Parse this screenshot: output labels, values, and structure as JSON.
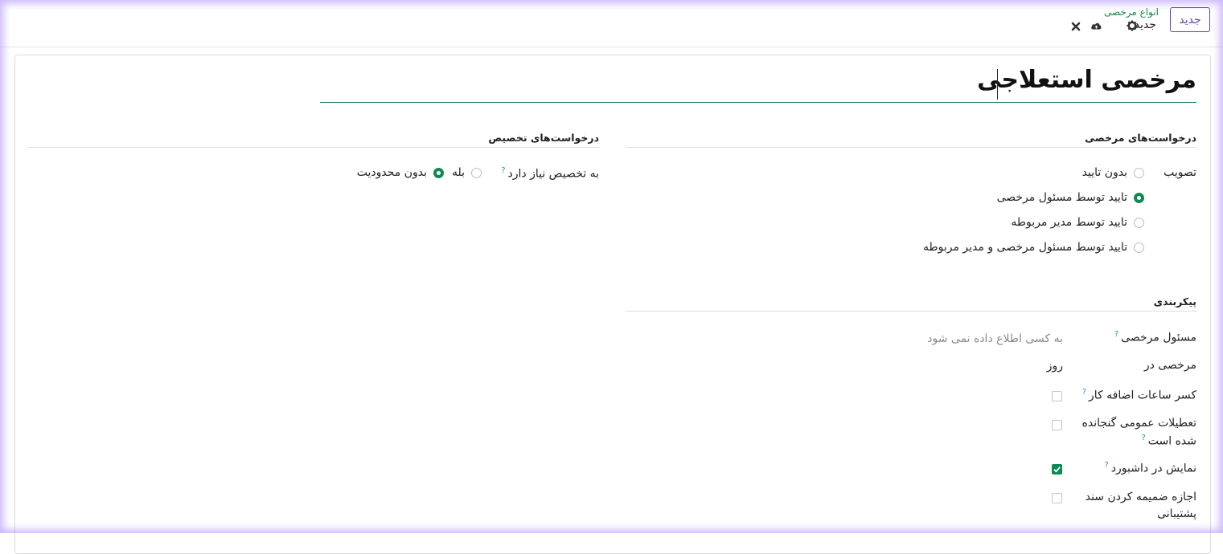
{
  "control_panel": {
    "new_button": "جدید",
    "breadcrumb_parent": "انواع مرخصی",
    "breadcrumb_current": "جدید",
    "icons": [
      "gear-icon",
      "cloud-upload-icon",
      "close-icon"
    ]
  },
  "form": {
    "title": "مرخصی استعلاجی",
    "leave_requests": {
      "heading": "درخواست‌های مرخصی",
      "approval_label": "تصویب",
      "options": [
        {
          "label": "بدون تایید",
          "checked": false
        },
        {
          "label": "تایید توسط مسئول مرخصی",
          "checked": true
        },
        {
          "label": "تایید توسط مدیر مربوطه",
          "checked": false
        },
        {
          "label": "تایید توسط مسئول مرخصی و مدیر مربوطه",
          "checked": false
        }
      ]
    },
    "allocation_requests": {
      "heading": "درخواست‌های تخصیص",
      "requires_allocation_label": "به تخصیص نیاز دارد",
      "options": [
        {
          "label": "بله",
          "checked": false
        },
        {
          "label": "بدون محدودیت",
          "checked": true
        }
      ]
    },
    "configuration": {
      "heading": "پیکربندی",
      "responsible_label": "مسئول مرخصی",
      "responsible_placeholder": "به کسی اطلاع داده نمی شود",
      "take_in_label": "مرخصی در",
      "take_in_value": "روز",
      "deduct_extra_hours_label": "کسر ساعات اضافه کار",
      "deduct_extra_hours": false,
      "public_holidays_label_1": "تعطیلات عمومی گنجانده",
      "public_holidays_label_2": "شده است",
      "public_holidays": false,
      "show_dashboard_label": "نمایش در داشبورد",
      "show_dashboard": true,
      "allow_attach_label_1": "اجازه ضمیمه کردن سند",
      "allow_attach_label_2": "پشتیبانی",
      "allow_attach": false
    },
    "help_mark": "?",
    "accent_color": "#0f8a52",
    "brand_color": "#6b3fa0"
  }
}
